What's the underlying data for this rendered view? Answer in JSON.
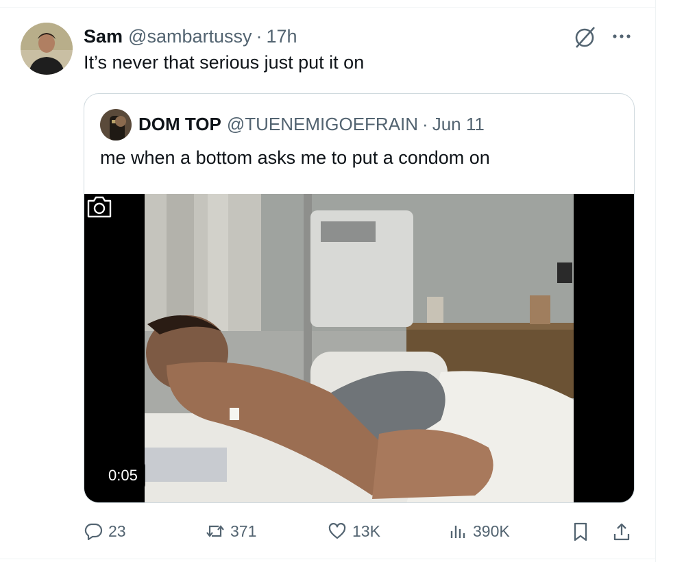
{
  "tweet": {
    "display_name": "Sam",
    "handle": "@sambartussy",
    "separator": "·",
    "time": "17h",
    "text": "It’s never that serious just put it on",
    "avatar_icon": "user-avatar",
    "more_icon": "more-horizontal-icon",
    "grok_icon": "grok-icon"
  },
  "quote": {
    "display_name": "DOM TOP",
    "handle": "@TUENEMIGOEFRAIN",
    "separator": "·",
    "date": "Jun 11",
    "text": "me when a bottom asks me to put a condom on",
    "media": {
      "kind": "video",
      "timestamp": "0:05",
      "overlay_icon": "camera-icon"
    }
  },
  "actions": {
    "replies": "23",
    "reposts": "371",
    "likes": "13K",
    "views": "390K",
    "bookmark_icon": "bookmark-icon",
    "share_icon": "share-icon"
  },
  "colors": {
    "text_primary": "#0f1419",
    "text_secondary": "#536471",
    "border": "#cfd9de"
  }
}
